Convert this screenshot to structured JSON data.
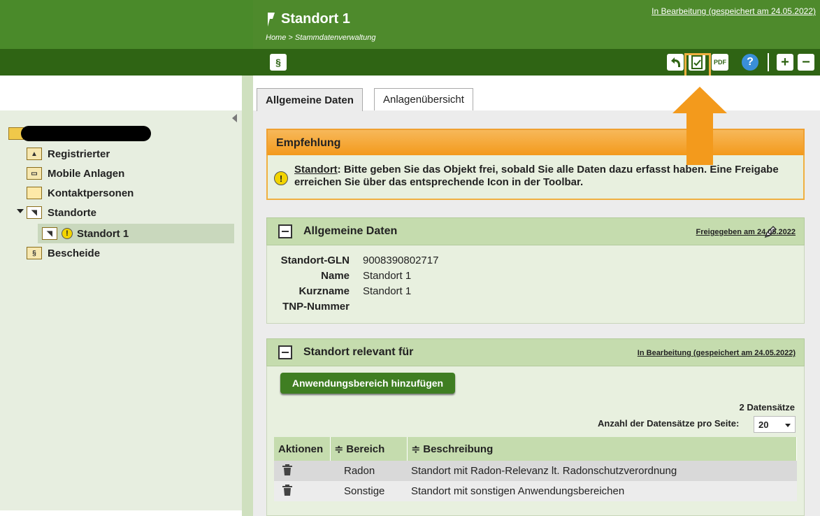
{
  "header": {
    "title": "Standort 1",
    "breadcrumb": "Home > Stammdatenverwaltung",
    "status": "In Bearbeitung (gespeichert am 24.05.2022)"
  },
  "toolbar": {
    "paragraph_label": "§",
    "pdf_label": "PDF",
    "help_label": "?"
  },
  "sidebar": {
    "items": [
      {
        "label": "Registrierter"
      },
      {
        "label": "Mobile Anlagen"
      },
      {
        "label": "Kontaktpersonen"
      },
      {
        "label": "Standorte"
      },
      {
        "label": "Standort 1"
      },
      {
        "label": "Bescheide"
      }
    ]
  },
  "tabs": [
    {
      "label": "Allgemeine Daten",
      "active": true
    },
    {
      "label": "Anlagenübersicht",
      "active": false
    }
  ],
  "recommendation": {
    "title": "Empfehlung",
    "link": "Standort",
    "text": ": Bitte geben Sie das Objekt frei, sobald Sie alle Daten dazu erfasst haben. Eine Freigabe erreichen Sie über das entsprechende Icon in der Toolbar."
  },
  "general": {
    "title": "Allgemeine Daten",
    "status": "Freigegeben am 24.05.2022",
    "fields": [
      {
        "label": "Standort-GLN",
        "value": "9008390802717"
      },
      {
        "label": "Name",
        "value": "Standort 1"
      },
      {
        "label": "Kurzname",
        "value": "Standort 1"
      },
      {
        "label": "TNP-Nummer",
        "value": ""
      }
    ]
  },
  "relevant": {
    "title": "Standort relevant für",
    "status": "In Bearbeitung (gespeichert am 24.05.2022)",
    "add_button": "Anwendungsbereich hinzufügen",
    "count": "2 Datensätze",
    "per_page_label": "Anzahl der Datensätze pro Seite:",
    "per_page_value": "20",
    "columns": [
      "Aktionen",
      "≑ Bereich",
      "≑ Beschreibung"
    ],
    "rows": [
      {
        "bereich": "Radon",
        "beschreibung": "Standort mit Radon-Relevanz lt. Radonschutzverordnung"
      },
      {
        "bereich": "Sonstige",
        "beschreibung": "Standort mit sonstigen Anwendungsbereichen"
      }
    ]
  },
  "colors": {
    "header_green": "#4e8a2c",
    "toolbar_green": "#2f6414",
    "accent_orange": "#f39a1c"
  }
}
